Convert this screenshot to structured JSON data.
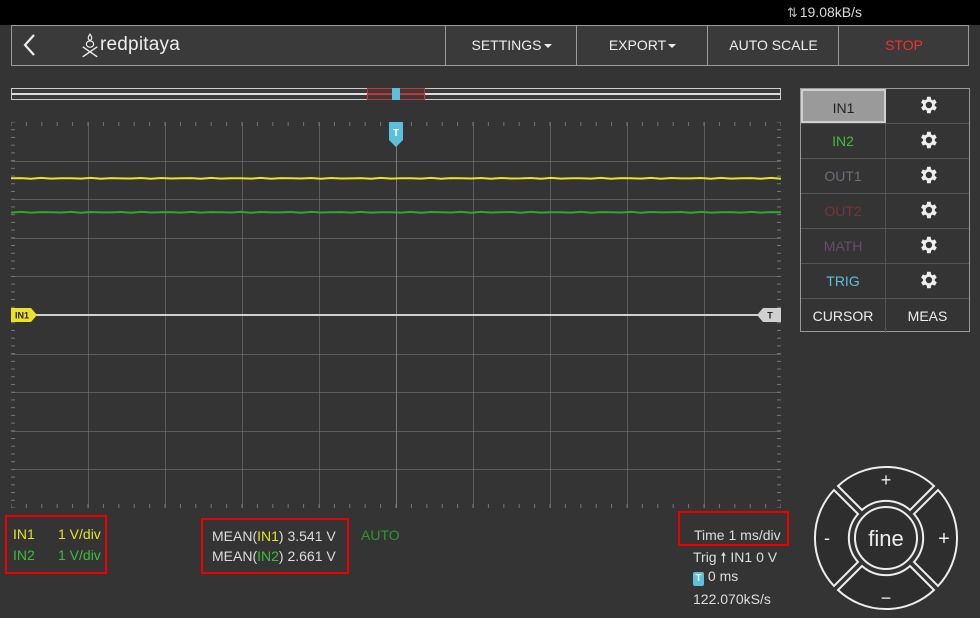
{
  "status": {
    "speed": "19.08kB/s"
  },
  "nav": {
    "back_icon": "chevron-left-icon",
    "logo_text": "redpitaya",
    "buttons": {
      "settings": "SETTINGS",
      "export": "EXPORT",
      "autoscale": "AUTO SCALE",
      "stop": "STOP"
    }
  },
  "channels": [
    {
      "label": "IN1",
      "color": "#222222",
      "selected": true
    },
    {
      "label": "IN2",
      "color": "#3bbf3b"
    },
    {
      "label": "OUT1",
      "color": "#6d6d79"
    },
    {
      "label": "OUT2",
      "color": "#7a3535"
    },
    {
      "label": "MATH",
      "color": "#6a4a6f"
    },
    {
      "label": "TRIG",
      "color": "#5bc0de"
    }
  ],
  "tools": {
    "cursor": "CURSOR",
    "meas": "MEAS"
  },
  "plot": {
    "trigger_marker": "T",
    "in1_marker": "IN1",
    "trig_level_marker": "T",
    "traces": [
      {
        "name": "IN1",
        "color": "#e8e22a",
        "level": 3.541
      },
      {
        "name": "IN2",
        "color": "#2fa82f",
        "level": 2.661
      }
    ],
    "colors": {
      "grid": "#777777",
      "bg": "#343434"
    }
  },
  "scales": {
    "in1_label": "IN1",
    "in1_value": "1 V/div",
    "in2_label": "IN2",
    "in2_value": "1 V/div"
  },
  "measurements": {
    "m1_prefix": "MEAN(",
    "m1_ch": "IN1",
    "m1_suffix": ") 3.541 V",
    "m2_prefix": "MEAN(",
    "m2_ch": "IN2",
    "m2_suffix": ") 2.661 V",
    "mode": "AUTO"
  },
  "timing": {
    "time": "Time 1 ms/div",
    "trig_prefix": "Trig",
    "trig_suffix": "IN1 0 V",
    "offset_badge": "T",
    "offset": "0 ms",
    "rate": "122.070kS/s"
  },
  "wheel": {
    "center": "fine",
    "up": "+",
    "down": "−",
    "left": "-",
    "right": "+"
  }
}
